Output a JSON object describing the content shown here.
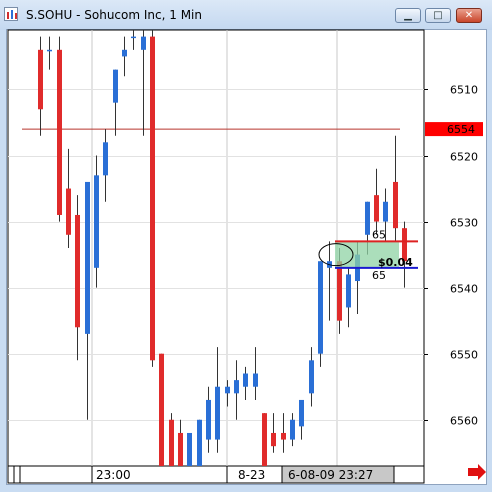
{
  "window": {
    "title": "S.SOHU - Sohucom Inc, 1 Min",
    "icon": "chart-app-icon",
    "buttons": [
      "minimize",
      "maximize",
      "close"
    ]
  },
  "chart": {
    "price_ticks": [
      "6560",
      "6550",
      "6540",
      "6530",
      "6520",
      "6510"
    ],
    "current_price_label": "6554",
    "current_price_color": "#ff0000",
    "position_label": "$0.04",
    "qty_top": "65",
    "qty_bottom": "65",
    "time_labels": [
      "23:00",
      "8-23"
    ],
    "crosshair_time": "6-08-09 23:27",
    "up_color": "#2a6fd6",
    "down_color": "#e02b2b"
  },
  "chart_data": {
    "type": "candlestick",
    "title": "S.SOHU - Sohucom Inc, 1 Min",
    "xlabel": "",
    "ylabel": "",
    "ylim": [
      6503,
      6569
    ],
    "y_ticks": [
      6510,
      6520,
      6530,
      6540,
      6550,
      6560
    ],
    "horizontal_lines": [
      6554,
      6537,
      6533
    ],
    "candles": [
      {
        "o": 6566,
        "h": 6568,
        "l": 6553,
        "c": 6557
      },
      {
        "o": 6566,
        "h": 6568,
        "l": 6563,
        "c": 6566
      },
      {
        "o": 6566,
        "h": 6568,
        "l": 6540,
        "c": 6541
      },
      {
        "o": 6545,
        "h": 6551,
        "l": 6536,
        "c": 6538
      },
      {
        "o": 6541,
        "h": 6544,
        "l": 6519,
        "c": 6524
      },
      {
        "o": 6523,
        "h": 6546,
        "l": 6510,
        "c": 6546
      },
      {
        "o": 6533,
        "h": 6550,
        "l": 6530,
        "c": 6547
      },
      {
        "o": 6547,
        "h": 6554,
        "l": 6543,
        "c": 6552
      },
      {
        "o": 6558,
        "h": 6563,
        "l": 6553,
        "c": 6563
      },
      {
        "o": 6565,
        "h": 6568,
        "l": 6562,
        "c": 6566
      },
      {
        "o": 6568,
        "h": 6569,
        "l": 6566,
        "c": 6568
      },
      {
        "o": 6566,
        "h": 6569,
        "l": 6553,
        "c": 6568
      },
      {
        "o": 6568,
        "h": 6569,
        "l": 6518,
        "c": 6519
      },
      {
        "o": 6520,
        "h": 6520,
        "l": 6503,
        "c": 6503
      },
      {
        "o": 6510,
        "h": 6511,
        "l": 6503,
        "c": 6503
      },
      {
        "o": 6508,
        "h": 6510,
        "l": 6503,
        "c": 6503
      },
      {
        "o": 6503,
        "h": 6505,
        "l": 6503,
        "c": 6508
      },
      {
        "o": 6503,
        "h": 6510,
        "l": 6503,
        "c": 6510
      },
      {
        "o": 6507,
        "h": 6515,
        "l": 6505,
        "c": 6513
      },
      {
        "o": 6507,
        "h": 6521,
        "l": 6505,
        "c": 6515
      },
      {
        "o": 6514,
        "h": 6516,
        "l": 6512,
        "c": 6515
      },
      {
        "o": 6514,
        "h": 6519,
        "l": 6510,
        "c": 6516
      },
      {
        "o": 6515,
        "h": 6518,
        "l": 6513,
        "c": 6517
      },
      {
        "o": 6515,
        "h": 6521,
        "l": 6513,
        "c": 6517
      },
      {
        "o": 6511,
        "h": 6511,
        "l": 6503,
        "c": 6503
      },
      {
        "o": 6508,
        "h": 6511,
        "l": 6505,
        "c": 6506
      },
      {
        "o": 6508,
        "h": 6511,
        "l": 6505,
        "c": 6507
      },
      {
        "o": 6507,
        "h": 6511,
        "l": 6506,
        "c": 6510
      },
      {
        "o": 6509,
        "h": 6513,
        "l": 6507,
        "c": 6513
      },
      {
        "o": 6514,
        "h": 6521,
        "l": 6512,
        "c": 6519
      },
      {
        "o": 6520,
        "h": 6534,
        "l": 6518,
        "c": 6534
      },
      {
        "o": 6533,
        "h": 6537,
        "l": 6525,
        "c": 6534
      },
      {
        "o": 6534,
        "h": 6536,
        "l": 6523,
        "c": 6525
      },
      {
        "o": 6527,
        "h": 6533,
        "l": 6524,
        "c": 6532
      },
      {
        "o": 6531,
        "h": 6537,
        "l": 6526,
        "c": 6535
      },
      {
        "o": 6538,
        "h": 6543,
        "l": 6535,
        "c": 6543
      },
      {
        "o": 6544,
        "h": 6548,
        "l": 6538,
        "c": 6540
      },
      {
        "o": 6540,
        "h": 6545,
        "l": 6537,
        "c": 6543
      },
      {
        "o": 6546,
        "h": 6553,
        "l": 6537,
        "c": 6539
      },
      {
        "o": 6539,
        "h": 6540,
        "l": 6530,
        "c": 6534
      }
    ]
  }
}
